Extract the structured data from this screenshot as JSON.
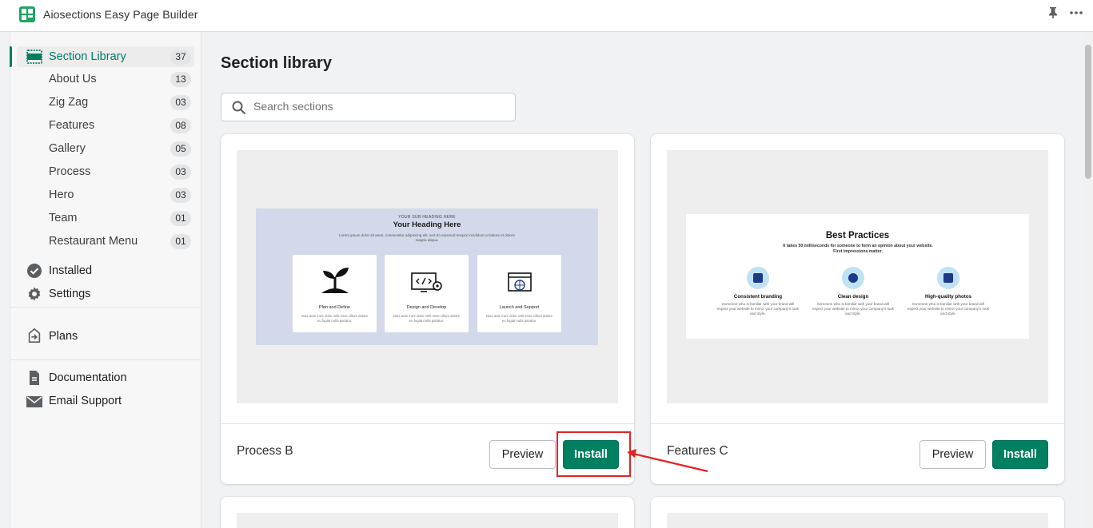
{
  "app": {
    "title": "Aiosections Easy Page Builder"
  },
  "icons": {
    "logo": "grid-logo-icon",
    "pin": "pin-icon",
    "more": "more-horizontal-icon",
    "search": "search-icon",
    "check": "check-circle-icon",
    "settings": "gear-icon",
    "plans": "plans-icon",
    "docs": "document-icon",
    "email": "envelope-icon"
  },
  "sidebar": {
    "section_library": {
      "label": "Section Library",
      "count": "37"
    },
    "categories": [
      {
        "label": "About Us",
        "count": "13"
      },
      {
        "label": "Zig Zag",
        "count": "03"
      },
      {
        "label": "Features",
        "count": "08"
      },
      {
        "label": "Gallery",
        "count": "05"
      },
      {
        "label": "Process",
        "count": "03"
      },
      {
        "label": "Hero",
        "count": "03"
      },
      {
        "label": "Team",
        "count": "01"
      },
      {
        "label": "Restaurant Menu",
        "count": "01"
      }
    ],
    "installed": "Installed",
    "settings": "Settings",
    "plans": "Plans",
    "documentation": "Documentation",
    "email_support": "Email Support"
  },
  "main": {
    "title": "Section library",
    "search": {
      "placeholder": "Search sections",
      "value": ""
    },
    "cards": [
      {
        "name": "Process B",
        "preview_label": "Preview",
        "install_label": "Install",
        "thumb": {
          "sub": "YOUR SUB HEADING HERE",
          "heading": "Your Heading Here",
          "desc": "Lorem ipsum dolor sit amet, consectetur adipiscing elit, sed do eiusmod tempor incididunt ut labore et dolore magna aliqua.",
          "items": [
            {
              "title": "Plan and Define",
              "desc": "Duis aute irure dolor velit esse cillum dolore eu fugiat nulla pariatur."
            },
            {
              "title": "Design and Develop",
              "desc": "Duis aute irure dolor velit esse cillum dolore eu fugiat nulla pariatur."
            },
            {
              "title": "Launch and Support",
              "desc": "Duis aute irure dolor velit esse cillum dolore eu fugiat nulla pariatur."
            }
          ]
        }
      },
      {
        "name": "Features C",
        "preview_label": "Preview",
        "install_label": "Install",
        "thumb": {
          "heading": "Best Practices",
          "desc": "It takes 50 milliseconds for someone to form an opinion about your website. First impressions matter.",
          "items": [
            {
              "title": "Consistent branding",
              "desc": "Someone who is familiar with your brand will expect your website to mirror your company's look and style."
            },
            {
              "title": "Clean design",
              "desc": "Someone who is familiar with your brand will expect your website to mirror your company's look and style."
            },
            {
              "title": "High-quality photos",
              "desc": "Someone who is familiar with your brand will expect your website to mirror your company's look and style."
            }
          ]
        }
      }
    ]
  },
  "colors": {
    "accent": "#008060",
    "highlight": "#e32424"
  }
}
